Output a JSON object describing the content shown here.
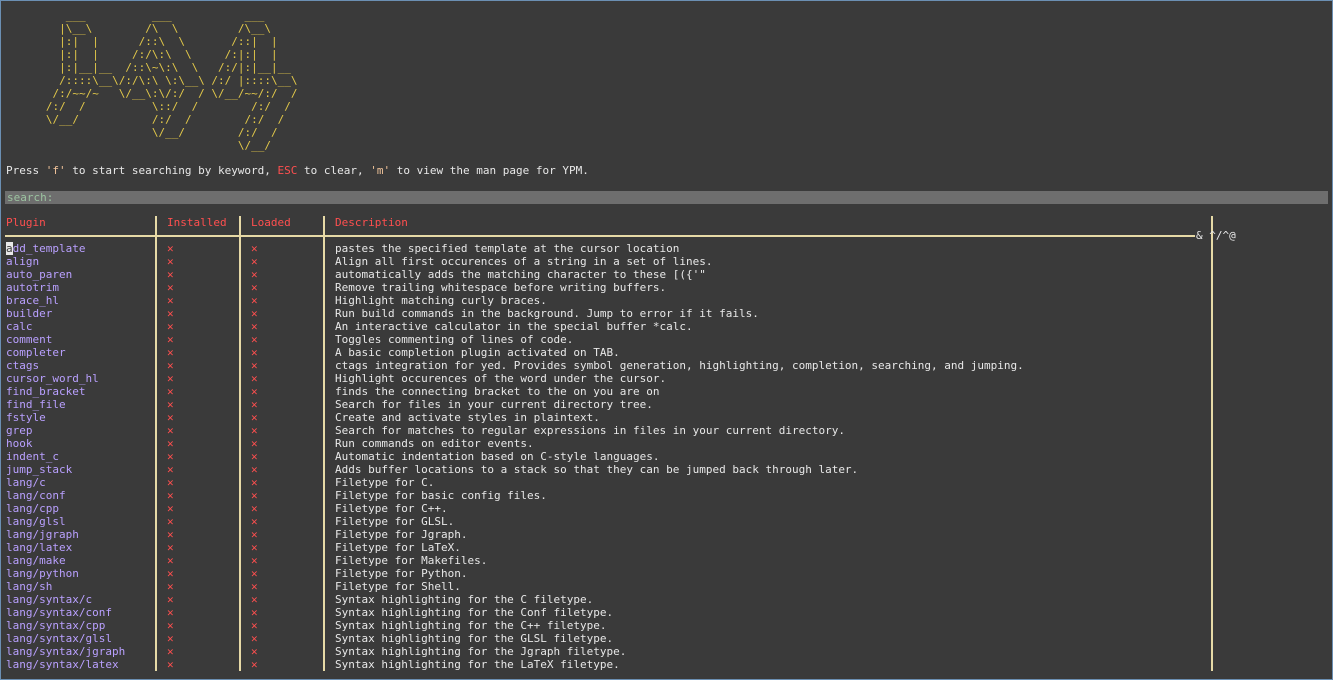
{
  "logo_ascii": "      ___          ___           ___\n     |\\__\\        /\\  \\         /\\__\\\n     |:|  |      /::\\  \\       /::|  |\n     |:|  |     /:/\\:\\  \\     /:|:|  |\n     |:|__|__  /::\\~\\:\\  \\   /:/|:|__|__\n     /::::\\__\\/:/\\:\\ \\:\\__\\ /:/ |::::\\__\\\n    /:/~~/~   \\/__\\:\\/:/  / \\/__/~~/:/  /\n   /:/  /          \\::/  /        /:/  /\n   \\/__/           /:/  /        /:/  /\n                   \\/__/        /:/  /\n                                \\/__/",
  "help": {
    "press": "Press ",
    "f_key": "'f'",
    "mid1": " to start searching by keyword, ",
    "esc_key": "ESC",
    "mid2": " to clear, ",
    "m_key": "'m'",
    "end": " to view the man page for YPM."
  },
  "search": {
    "label": "search:"
  },
  "columns": {
    "plugin": "Plugin",
    "installed": "Installed",
    "loaded": "Loaded",
    "description": "Description"
  },
  "control_chars": "& ^/^@",
  "cursor_char": "a",
  "rows": [
    {
      "name": "dd_template",
      "inst": "✕",
      "load": "✕",
      "desc": "pastes the specified template at the cursor location"
    },
    {
      "name": "align",
      "inst": "✕",
      "load": "✕",
      "desc": "Align all first occurences of a string in a set of lines."
    },
    {
      "name": "auto_paren",
      "inst": "✕",
      "load": "✕",
      "desc": "automatically adds the matching character to these [({'\""
    },
    {
      "name": "autotrim",
      "inst": "✕",
      "load": "✕",
      "desc": "Remove trailing whitespace before writing buffers."
    },
    {
      "name": "brace_hl",
      "inst": "✕",
      "load": "✕",
      "desc": "Highlight matching curly braces."
    },
    {
      "name": "builder",
      "inst": "✕",
      "load": "✕",
      "desc": "Run build commands in the background. Jump to error if it fails."
    },
    {
      "name": "calc",
      "inst": "✕",
      "load": "✕",
      "desc": "An interactive calculator in the special buffer *calc."
    },
    {
      "name": "comment",
      "inst": "✕",
      "load": "✕",
      "desc": "Toggles commenting of lines of code."
    },
    {
      "name": "completer",
      "inst": "✕",
      "load": "✕",
      "desc": "A basic completion plugin activated on TAB."
    },
    {
      "name": "ctags",
      "inst": "✕",
      "load": "✕",
      "desc": "ctags integration for yed. Provides symbol generation, highlighting, completion, searching, and jumping."
    },
    {
      "name": "cursor_word_hl",
      "inst": "✕",
      "load": "✕",
      "desc": "Highlight occurences of the word under the cursor."
    },
    {
      "name": "find_bracket",
      "inst": "✕",
      "load": "✕",
      "desc": "finds the connecting bracket to the on you are on"
    },
    {
      "name": "find_file",
      "inst": "✕",
      "load": "✕",
      "desc": "Search for files in your current directory tree."
    },
    {
      "name": "fstyle",
      "inst": "✕",
      "load": "✕",
      "desc": "Create and activate styles in plaintext."
    },
    {
      "name": "grep",
      "inst": "✕",
      "load": "✕",
      "desc": "Search for matches to regular expressions in files in your current directory."
    },
    {
      "name": "hook",
      "inst": "✕",
      "load": "✕",
      "desc": "Run commands on editor events."
    },
    {
      "name": "indent_c",
      "inst": "✕",
      "load": "✕",
      "desc": "Automatic indentation based on C-style languages."
    },
    {
      "name": "jump_stack",
      "inst": "✕",
      "load": "✕",
      "desc": "Adds buffer locations to a stack so that they can be jumped back through later."
    },
    {
      "name": "lang/c",
      "inst": "✕",
      "load": "✕",
      "desc": "Filetype for C."
    },
    {
      "name": "lang/conf",
      "inst": "✕",
      "load": "✕",
      "desc": "Filetype for basic config files."
    },
    {
      "name": "lang/cpp",
      "inst": "✕",
      "load": "✕",
      "desc": "Filetype for C++."
    },
    {
      "name": "lang/glsl",
      "inst": "✕",
      "load": "✕",
      "desc": "Filetype for GLSL."
    },
    {
      "name": "lang/jgraph",
      "inst": "✕",
      "load": "✕",
      "desc": "Filetype for Jgraph."
    },
    {
      "name": "lang/latex",
      "inst": "✕",
      "load": "✕",
      "desc": "Filetype for LaTeX."
    },
    {
      "name": "lang/make",
      "inst": "✕",
      "load": "✕",
      "desc": "Filetype for Makefiles."
    },
    {
      "name": "lang/python",
      "inst": "✕",
      "load": "✕",
      "desc": "Filetype for Python."
    },
    {
      "name": "lang/sh",
      "inst": "✕",
      "load": "✕",
      "desc": "Filetype for Shell."
    },
    {
      "name": "lang/syntax/c",
      "inst": "✕",
      "load": "✕",
      "desc": "Syntax highlighting for the C filetype."
    },
    {
      "name": "lang/syntax/conf",
      "inst": "✕",
      "load": "✕",
      "desc": "Syntax highlighting for the Conf filetype."
    },
    {
      "name": "lang/syntax/cpp",
      "inst": "✕",
      "load": "✕",
      "desc": "Syntax highlighting for the C++ filetype."
    },
    {
      "name": "lang/syntax/glsl",
      "inst": "✕",
      "load": "✕",
      "desc": "Syntax highlighting for the GLSL filetype."
    },
    {
      "name": "lang/syntax/jgraph",
      "inst": "✕",
      "load": "✕",
      "desc": "Syntax highlighting for the Jgraph filetype."
    },
    {
      "name": "lang/syntax/latex",
      "inst": "✕",
      "load": "✕",
      "desc": "Syntax highlighting for the LaTeX filetype."
    }
  ]
}
